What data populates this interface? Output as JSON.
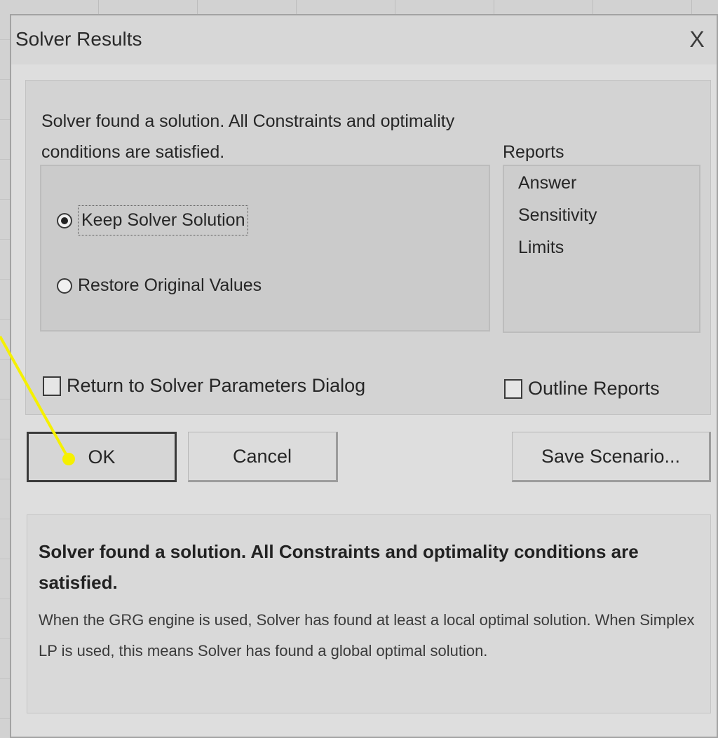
{
  "dialog": {
    "title": "Solver Results",
    "close_glyph": "X"
  },
  "status": {
    "message": "Solver found a solution.  All Constraints and optimality conditions are satisfied."
  },
  "options": {
    "keep_solution_label": "Keep Solver Solution",
    "restore_values_label": "Restore Original Values",
    "selected": "keep"
  },
  "reports": {
    "label": "Reports",
    "items": [
      "Answer",
      "Sensitivity",
      "Limits"
    ]
  },
  "checkboxes": {
    "return_label": "Return to Solver Parameters Dialog",
    "outline_label": "Outline Reports"
  },
  "buttons": {
    "ok": "OK",
    "cancel": "Cancel",
    "save_scenario": "Save Scenario..."
  },
  "info": {
    "heading": "Solver found a solution.  All Constraints and optimality conditions are satisfied.",
    "body": "When the GRG engine is used, Solver has found at least a local optimal solution. When Simplex LP is used, this means Solver has found a global optimal solution."
  },
  "annotation": {
    "pointer_color": "#f5f000"
  }
}
